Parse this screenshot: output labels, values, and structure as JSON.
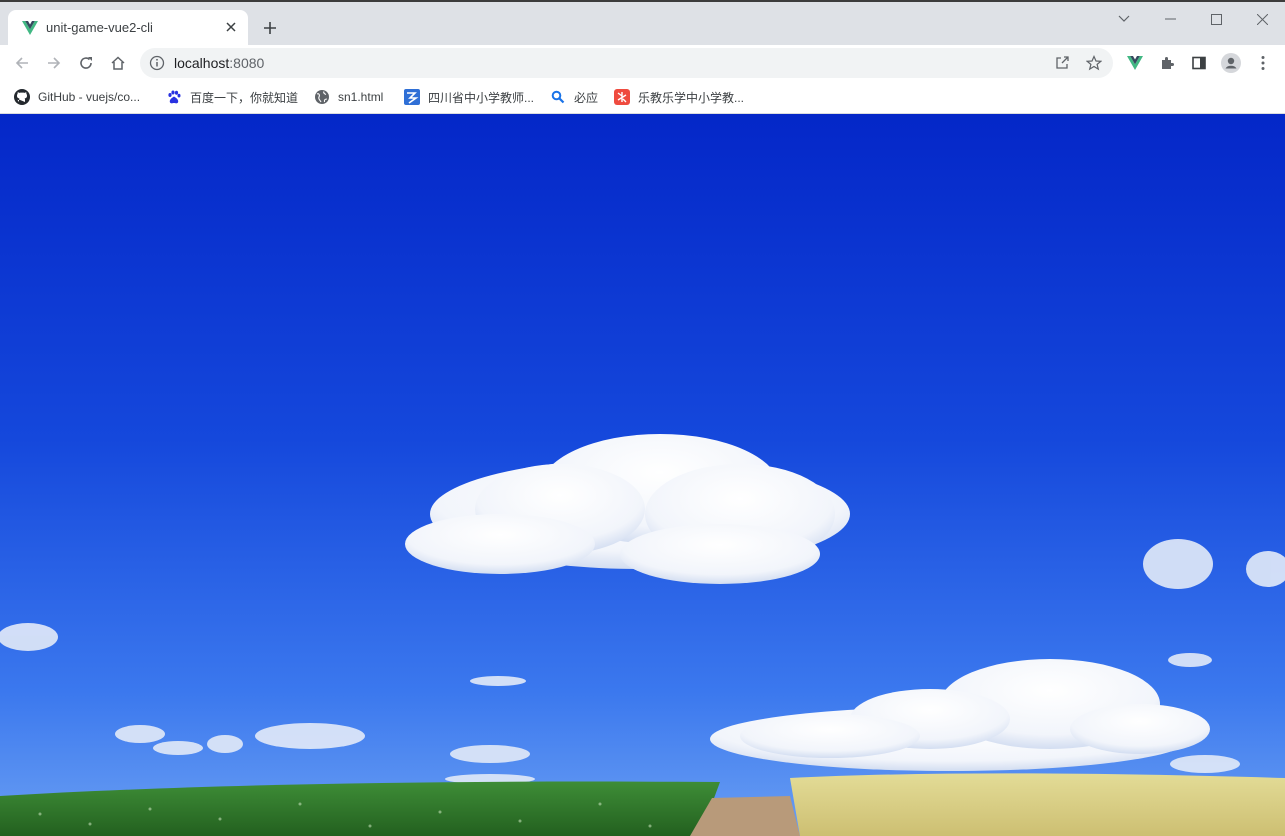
{
  "tab": {
    "title": "unit-game-vue2-cli",
    "favicon": "vue-logo-icon"
  },
  "address_bar": {
    "host": "localhost",
    "port": ":8080"
  },
  "bookmarks": [
    {
      "label": "GitHub - vuejs/co...",
      "icon": "github-icon"
    },
    {
      "label": "百度一下，你就知道",
      "icon": "baidu-paw-icon"
    },
    {
      "label": "sn1.html",
      "icon": "globe-icon"
    },
    {
      "label": "四川省中小学教师...",
      "icon": "sichuan-teacher-icon"
    },
    {
      "label": "必应",
      "icon": "bing-search-icon"
    },
    {
      "label": "乐教乐学中小学教...",
      "icon": "lejiao-icon"
    }
  ],
  "colors": {
    "tabstrip": "#dee1e6",
    "vue_green": "#41b883",
    "vue_dark": "#35495e",
    "sky_top": "#0a2fd0",
    "sky_bottom": "#4a86f0",
    "grass": "#2f7a2c",
    "wheat": "#d9cf86"
  },
  "content": {
    "image": "landscape-sky-clouds-field"
  }
}
